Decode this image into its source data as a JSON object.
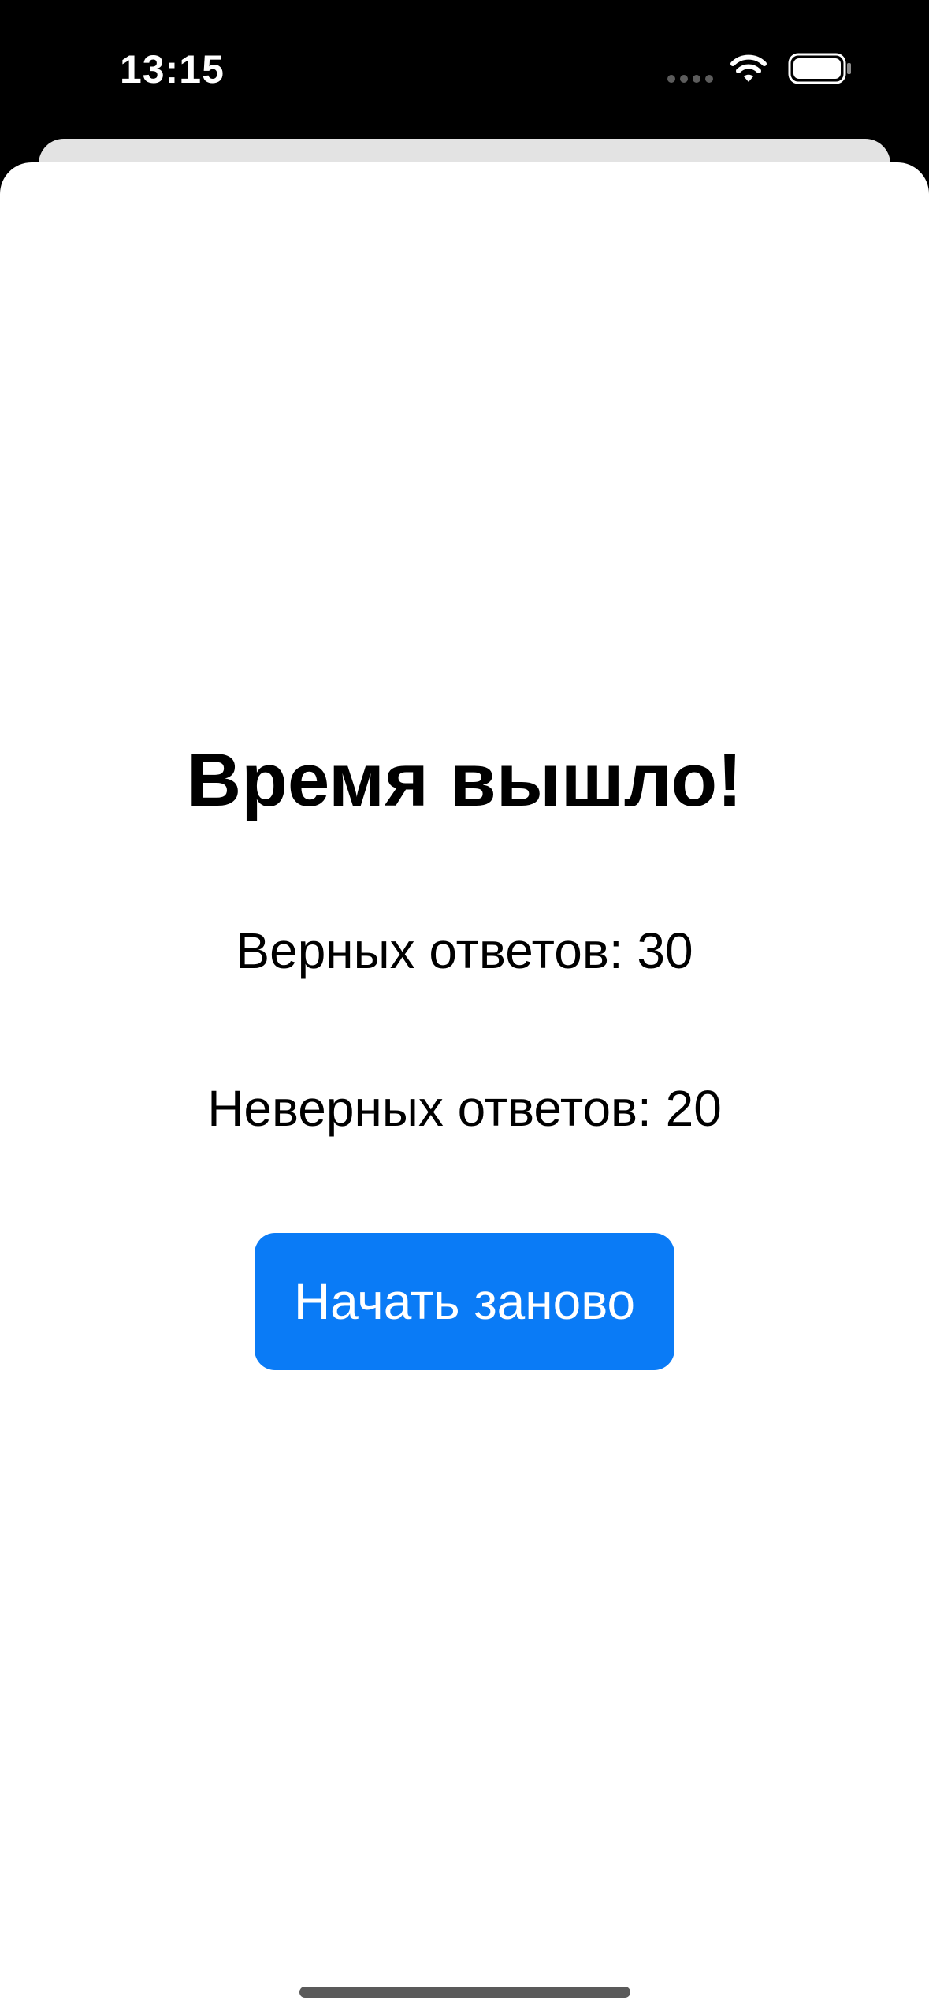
{
  "status_bar": {
    "time": "13:15",
    "icons": [
      "cellular-dots-icon",
      "wifi-icon",
      "battery-icon"
    ]
  },
  "result_screen": {
    "title": "Время вышло!",
    "correct_answers_text": "Верных ответов: 30",
    "wrong_answers_text": "Неверных ответов: 20",
    "restart_button_label": "Начать заново"
  },
  "colors": {
    "accent": "#0a7bf6",
    "background": "#ffffff",
    "status_bar_bg": "#000000"
  }
}
